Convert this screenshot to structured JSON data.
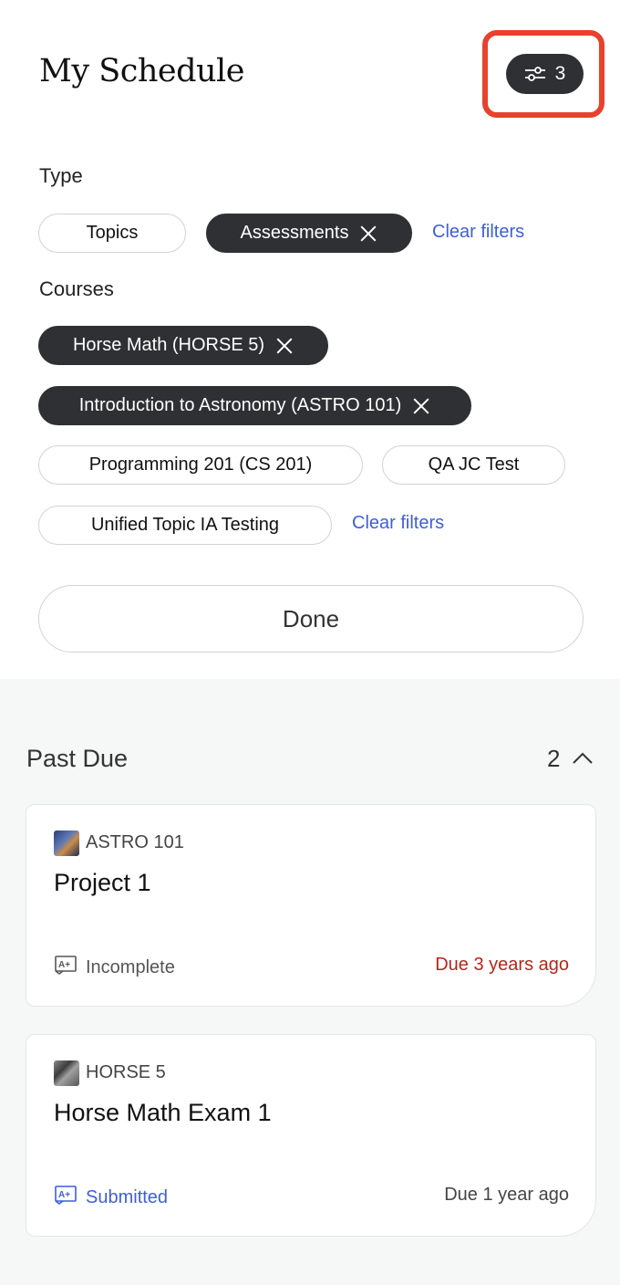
{
  "header": {
    "title": "My Schedule",
    "filter_count": "3"
  },
  "type_section": {
    "label": "Type",
    "chips": [
      {
        "label": "Topics",
        "active": false
      },
      {
        "label": "Assessments",
        "active": true
      }
    ],
    "clear_label": "Clear filters"
  },
  "courses_section": {
    "label": "Courses",
    "chips": [
      {
        "label": "Horse Math (HORSE 5)",
        "active": true
      },
      {
        "label": "Introduction to Astronomy (ASTRO 101)",
        "active": true
      },
      {
        "label": "Programming 201 (CS 201)",
        "active": false
      },
      {
        "label": "QA JC Test",
        "active": false
      },
      {
        "label": "Unified Topic IA Testing",
        "active": false
      }
    ],
    "clear_label": "Clear filters"
  },
  "done_label": "Done",
  "past_due": {
    "title": "Past Due",
    "count": "2",
    "items": [
      {
        "course": "ASTRO 101",
        "name": "Project 1",
        "status": "Incomplete",
        "due": "Due 3 years ago",
        "due_color": "#b3271c",
        "thumb_icon": "astronomy-thumbnail"
      },
      {
        "course": "HORSE 5",
        "name": "Horse Math Exam 1",
        "status": "Submitted",
        "due": "Due 1 year ago",
        "due_color": "#444444",
        "thumb_icon": "horse-thumbnail"
      }
    ]
  },
  "colors": {
    "active_chip": "#2f3033",
    "link": "#3d5fd8",
    "overdue": "#b3271c",
    "highlight": "#e8412c"
  }
}
